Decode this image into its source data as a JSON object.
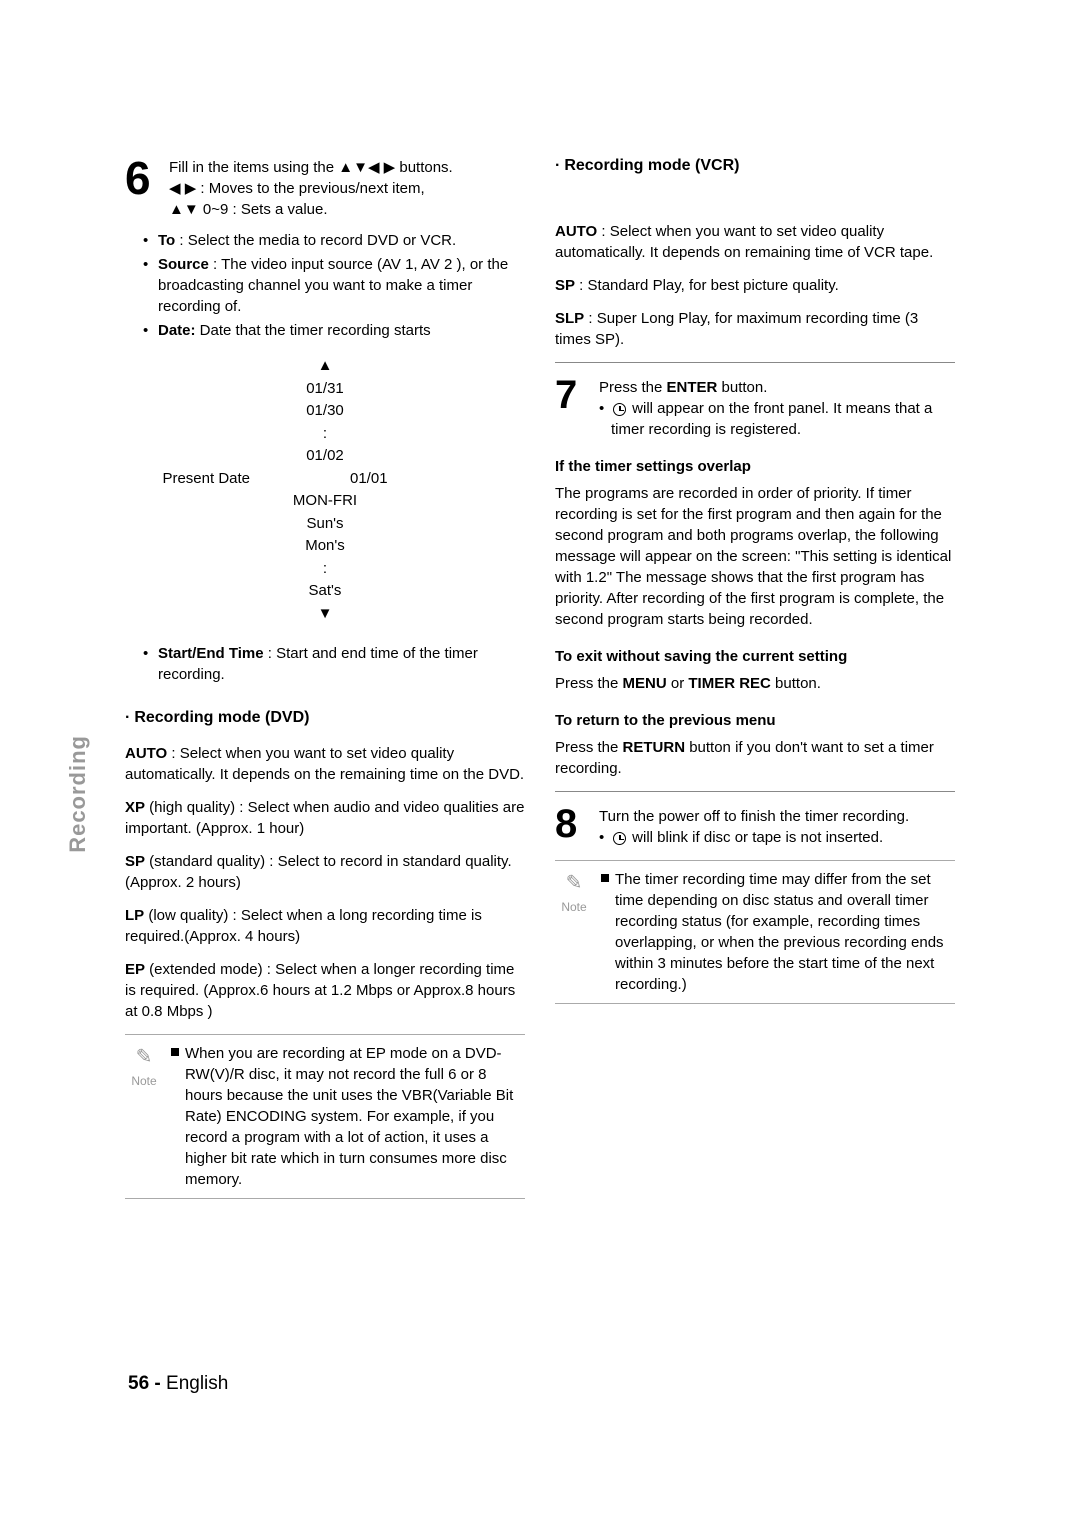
{
  "sideTab": "Recording",
  "pageNumber": "56 -",
  "pageLang": "English",
  "left": {
    "step6": {
      "num": "6",
      "line1a": "Fill in the items using the ",
      "line1b": " buttons.",
      "arrows1": "▲▼◀ ▶",
      "line2a": "◀ ▶",
      "line2b": " : Moves to the previous/next item,",
      "line3a": "▲▼",
      "line3b": " 0~9 : Sets a value."
    },
    "bulletTo": {
      "label": "To",
      "text": " : Select the media to record DVD or VCR."
    },
    "bulletSource": {
      "label": "Source",
      "text": " : The video input source (AV 1, AV 2 ), or the broadcasting channel you want to make a timer recording of."
    },
    "bulletDate": {
      "label": "Date:",
      "text": " Date that the timer recording starts"
    },
    "dates": {
      "up": "▲",
      "d1": "01/31",
      "d2": "01/30",
      "colon1": ":",
      "d3": "01/02",
      "present": "Present Date",
      "d4": "01/01",
      "d5": "MON-FRI",
      "d6": "Sun's",
      "d7": "Mon's",
      "colon2": ":",
      "d8": "Sat's",
      "down": "▼"
    },
    "bulletStart": {
      "label": "Start/End Time",
      "text": " : Start and end time of the timer recording."
    },
    "dvdTitle": "Recording mode (DVD)",
    "dvd": {
      "auto": {
        "label": "AUTO",
        "text": " : Select when you want to set video quality automatically. It depends on the remaining time on the DVD."
      },
      "xp": {
        "label": "XP",
        "paren": " (high quality) :",
        "text": " Select when audio and video qualities are important. (Approx. 1 hour)"
      },
      "sp": {
        "label": "SP",
        "paren": " (standard quality) :",
        "text": " Select to record in standard quality. (Approx. 2 hours)"
      },
      "lp": {
        "label": "LP",
        "paren": " (low quality) :",
        "text": " Select when a long recording time is required.(Approx. 4 hours)"
      },
      "ep": {
        "label": "EP",
        "paren": " (extended mode) :",
        "text": " Select when a longer recording time is required. (Approx.6 hours at 1.2 Mbps or Approx.8 hours at 0.8 Mbps )"
      }
    },
    "note": "When you are recording at EP mode on a DVD-RW(V)/R disc, it may not record the full 6 or 8 hours because the unit uses the VBR(Variable Bit Rate) ENCODING system. For example, if you record a program with a lot of action, it uses a higher bit rate which in turn consumes more disc memory.",
    "noteLabel": "Note"
  },
  "right": {
    "vcrTitle": "Recording mode (VCR)",
    "vcr": {
      "auto": {
        "label": "AUTO",
        "text": " : Select when you want to set video quality automatically. It depends on remaining time of VCR tape."
      },
      "sp": {
        "label": "SP",
        "text": " : Standard Play, for best picture quality."
      },
      "slp": {
        "label": "SLP",
        "text": " : Super Long Play, for maximum recording time (3 times SP)."
      }
    },
    "step7": {
      "num": "7",
      "line1a": "Press the ",
      "enter": "ENTER",
      "line1b": " button.",
      "line2": " will appear on the front panel. It means that a timer recording is registered."
    },
    "overlapTitle": "If the timer settings overlap",
    "overlapText": "The programs are recorded in order of priority. If timer recording is set for the first program and then again for the second program and both programs overlap, the following message will appear on the screen: \"This setting is identical with 1.2\" The message shows that the first program has priority. After recording of the first program is complete, the second program starts being recorded.",
    "exitTitle": "To exit without saving the current setting",
    "exitText1": "Press the ",
    "exitMenu": "MENU",
    "exitOr": " or ",
    "exitTimer": "TIMER REC",
    "exitText2": " button.",
    "returnTitle": "To return to the previous menu",
    "returnText1": "Press the ",
    "returnBtn": "RETURN",
    "returnText2": " button if you don't want to set a timer recording.",
    "step8": {
      "num": "8",
      "line1": "Turn the power off to finish the timer recording.",
      "line2": " will blink if disc or tape is not inserted."
    },
    "note": "The timer recording time may differ from the set time depending on disc status and overall timer recording status (for example, recording times overlapping, or when the previous recording ends within 3 minutes before the start time of the next recording.)",
    "noteLabel": "Note"
  }
}
